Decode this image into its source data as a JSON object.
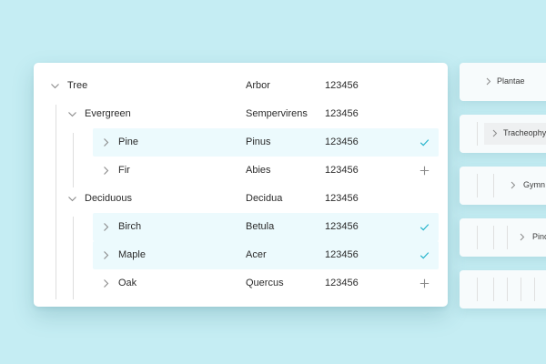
{
  "tree": {
    "rows": [
      {
        "label": "Tree",
        "latin": "Arbor",
        "code": "123456",
        "state": "expanded",
        "action": "none"
      },
      {
        "label": "Evergreen",
        "latin": "Sempervirens",
        "code": "123456",
        "state": "expanded",
        "action": "none"
      },
      {
        "label": "Pine",
        "latin": "Pinus",
        "code": "123456",
        "state": "collapsed",
        "action": "check"
      },
      {
        "label": "Fir",
        "latin": "Abies",
        "code": "123456",
        "state": "collapsed",
        "action": "add"
      },
      {
        "label": "Deciduous",
        "latin": "Decidua",
        "code": "123456",
        "state": "expanded",
        "action": "none"
      },
      {
        "label": "Birch",
        "latin": "Betula",
        "code": "123456",
        "state": "collapsed",
        "action": "check"
      },
      {
        "label": "Maple",
        "latin": "Acer",
        "code": "123456",
        "state": "collapsed",
        "action": "check"
      },
      {
        "label": "Oak",
        "latin": "Quercus",
        "code": "123456",
        "state": "collapsed",
        "action": "add"
      }
    ]
  },
  "side_cards": [
    {
      "label": "Plantae"
    },
    {
      "label": "Tracheophy"
    },
    {
      "label": "Gymn"
    },
    {
      "label": "Pinc"
    },
    {
      "label": ""
    }
  ],
  "colors": {
    "background": "#c5edf3",
    "selected_row": "#ecfafd",
    "check": "#27b4cc",
    "icon_gray": "#8a8a8a"
  },
  "icons": {
    "expanded": "chevron-down-icon",
    "collapsed": "chevron-right-icon",
    "check": "check-icon",
    "add": "plus-icon"
  }
}
